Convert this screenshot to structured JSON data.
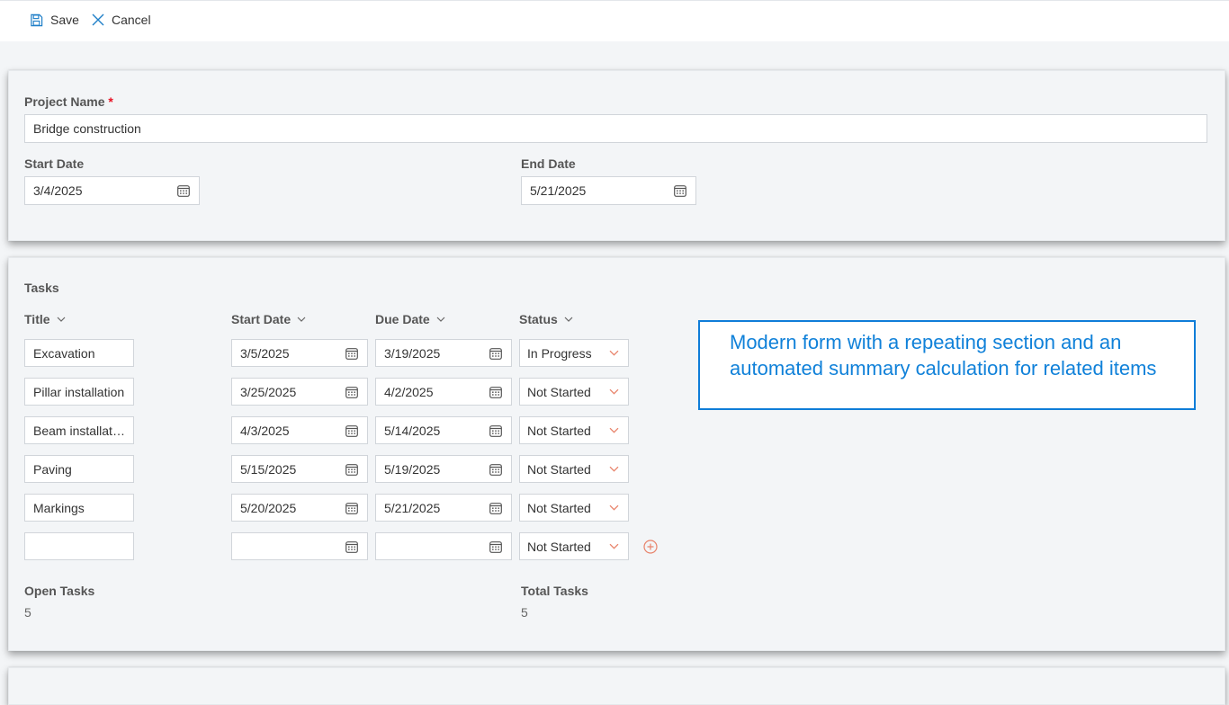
{
  "toolbar": {
    "save_label": "Save",
    "cancel_label": "Cancel"
  },
  "project": {
    "name_label": "Project Name",
    "required_mark": "*",
    "name_value": "Bridge construction",
    "start_label": "Start Date",
    "start_value": "3/4/2025",
    "end_label": "End Date",
    "end_value": "5/21/2025"
  },
  "tasks": {
    "section_title": "Tasks",
    "columns": {
      "title": "Title",
      "start": "Start Date",
      "due": "Due Date",
      "status": "Status"
    },
    "rows": [
      {
        "title": "Excavation",
        "start": "3/5/2025",
        "due": "3/19/2025",
        "status": "In Progress"
      },
      {
        "title": "Pillar installation",
        "start": "3/25/2025",
        "due": "4/2/2025",
        "status": "Not Started"
      },
      {
        "title": "Beam installation",
        "start": "4/3/2025",
        "due": "5/14/2025",
        "status": "Not Started"
      },
      {
        "title": "Paving",
        "start": "5/15/2025",
        "due": "5/19/2025",
        "status": "Not Started"
      },
      {
        "title": "Markings",
        "start": "5/20/2025",
        "due": "5/21/2025",
        "status": "Not Started"
      },
      {
        "title": "",
        "start": "",
        "due": "",
        "status": "Not Started"
      }
    ],
    "open_label": "Open Tasks",
    "open_value": "5",
    "total_label": "Total Tasks",
    "total_value": "5"
  },
  "note": "Modern form with a repeating section and an automated summary calculation for related items",
  "colors": {
    "accent": "#0f7dd8",
    "required": "#e81123",
    "status_chevron": "#e8836b",
    "add_icon": "#e8836b"
  },
  "icons": [
    "save-icon",
    "cancel-icon",
    "calendar-icon",
    "chevron-down-icon",
    "add-circle-icon"
  ]
}
